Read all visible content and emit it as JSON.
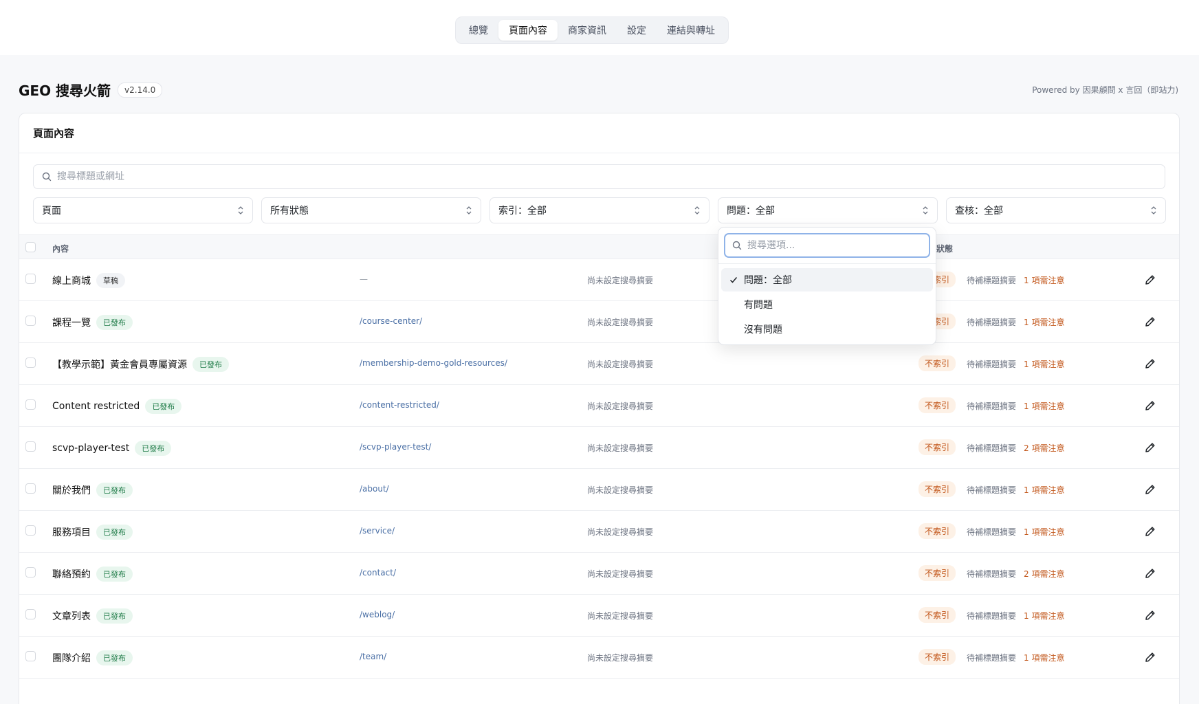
{
  "nav": {
    "tabs": [
      {
        "label": "總覽"
      },
      {
        "label": "頁面內容"
      },
      {
        "label": "商家資訊"
      },
      {
        "label": "設定"
      },
      {
        "label": "連結與轉址"
      }
    ],
    "active_tab": "頁面內容"
  },
  "header": {
    "app_name": "GEO 搜尋火箭",
    "version": "v2.14.0",
    "powered_by": "Powered by 因果顧問 x 言回（即站力)"
  },
  "card": {
    "title": "頁面內容",
    "search_placeholder": "搜尋標題或網址",
    "filters": [
      "頁面",
      "所有狀態",
      "索引：全部",
      "問題：全部",
      "查核：全部"
    ],
    "columns": {
      "content": "內容",
      "status": "狀態"
    }
  },
  "dropdown": {
    "search_placeholder": "搜尋選項...",
    "options": [
      "問題：全部",
      "有問題",
      "沒有問題"
    ],
    "selected": "問題：全部"
  },
  "rows": [
    {
      "title": "線上商城",
      "badge": "草稿",
      "badge_type": "draft",
      "url": "—",
      "snippet": "尚未設定搜尋摘要",
      "index": "不索引",
      "pending": "待補標題摘要",
      "notice": "1 項需注意"
    },
    {
      "title": "課程一覽",
      "badge": "已發布",
      "badge_type": "pub",
      "url": "/course-center/",
      "snippet": "尚未設定搜尋摘要",
      "index": "不索引",
      "pending": "待補標題摘要",
      "notice": "1 項需注意"
    },
    {
      "title": "【教學示範】黃金會員專屬資源",
      "badge": "已發布",
      "badge_type": "pub",
      "url": "/membership-demo-gold-resources/",
      "snippet": "尚未設定搜尋摘要",
      "index": "不索引",
      "pending": "待補標題摘要",
      "notice": "1 項需注意"
    },
    {
      "title": "Content restricted",
      "badge": "已發布",
      "badge_type": "pub",
      "url": "/content-restricted/",
      "snippet": "尚未設定搜尋摘要",
      "index": "不索引",
      "pending": "待補標題摘要",
      "notice": "1 項需注意"
    },
    {
      "title": "scvp-player-test",
      "badge": "已發布",
      "badge_type": "pub",
      "url": "/scvp-player-test/",
      "snippet": "尚未設定搜尋摘要",
      "index": "不索引",
      "pending": "待補標題摘要",
      "notice": "2 項需注意"
    },
    {
      "title": "關於我們",
      "badge": "已發布",
      "badge_type": "pub",
      "url": "/about/",
      "snippet": "尚未設定搜尋摘要",
      "index": "不索引",
      "pending": "待補標題摘要",
      "notice": "1 項需注意"
    },
    {
      "title": "服務項目",
      "badge": "已發布",
      "badge_type": "pub",
      "url": "/service/",
      "snippet": "尚未設定搜尋摘要",
      "index": "不索引",
      "pending": "待補標題摘要",
      "notice": "1 項需注意"
    },
    {
      "title": "聯絡預約",
      "badge": "已發布",
      "badge_type": "pub",
      "url": "/contact/",
      "snippet": "尚未設定搜尋摘要",
      "index": "不索引",
      "pending": "待補標題摘要",
      "notice": "2 項需注意"
    },
    {
      "title": "文章列表",
      "badge": "已發布",
      "badge_type": "pub",
      "url": "/weblog/",
      "snippet": "尚未設定搜尋摘要",
      "index": "不索引",
      "pending": "待補標題摘要",
      "notice": "1 項需注意"
    },
    {
      "title": "團隊介紹",
      "badge": "已發布",
      "badge_type": "pub",
      "url": "/team/",
      "snippet": "尚未設定搜尋摘要",
      "index": "不索引",
      "pending": "待補標題摘要",
      "notice": "1 項需注意"
    }
  ],
  "icons": {
    "search": "search-icon",
    "select": "chevron-updown-icon",
    "check": "check-icon",
    "edit": "pencil-icon"
  },
  "colors": {
    "published_bg": "#e8f6ee",
    "published_text": "#1d7a46",
    "warning": "#c2561a",
    "link": "#4a6fa5"
  }
}
